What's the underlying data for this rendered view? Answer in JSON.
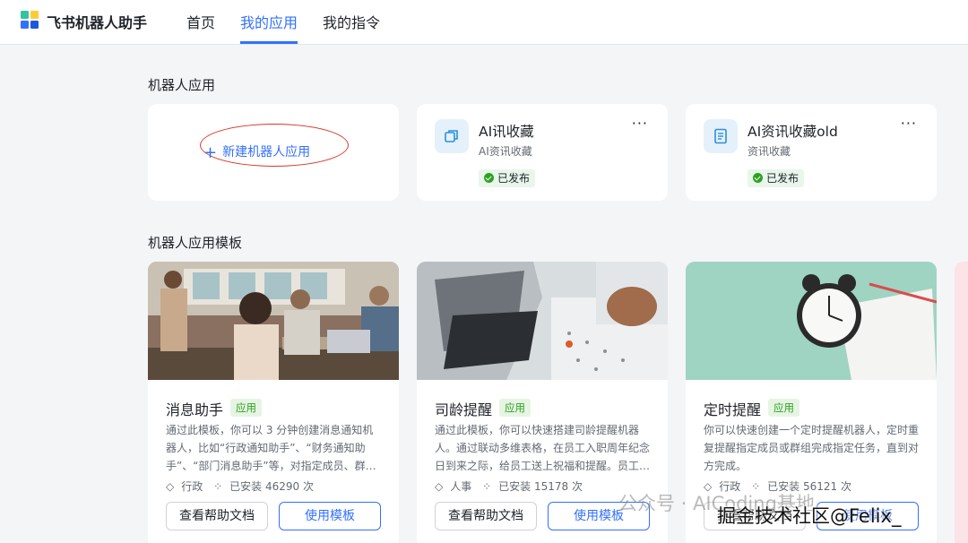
{
  "header": {
    "brand": "飞书机器人助手",
    "nav": [
      "首页",
      "我的应用",
      "我的指令"
    ],
    "active_nav": "我的应用"
  },
  "robot_apps": {
    "section_title": "机器人应用",
    "new_button_label": "新建机器人应用",
    "apps": [
      {
        "name": "AI讯收藏",
        "subtitle": "AI资讯收藏",
        "status": "已发布",
        "icon": "copy-icon"
      },
      {
        "name": "AI资讯收藏old",
        "subtitle": "资讯收藏",
        "status": "已发布",
        "icon": "document-icon"
      }
    ],
    "more_label": "···"
  },
  "templates": {
    "section_title": "机器人应用模板",
    "items": [
      {
        "title": "消息助手",
        "tag": "应用",
        "description": "通过此模板，你可以 3 分钟创建消息通知机器人，比如“行政通知助手”、“财务通知助手”、“部门消息助手”等，对指定成员、群…",
        "category": "行政",
        "installs": "已安装 46290 次",
        "help_label": "查看帮助文档",
        "use_label": "使用模板"
      },
      {
        "title": "司龄提醒",
        "tag": "应用",
        "description": "通过此模板，你可以快速搭建司龄提醒机器人。通过联动多维表格，在员工入职周年纪念日到来之际，给员工送上祝福和提醒。员工…",
        "category": "人事",
        "installs": "已安装 15178 次",
        "help_label": "查看帮助文档",
        "use_label": "使用模板"
      },
      {
        "title": "定时提醒",
        "tag": "应用",
        "description": "你可以快速创建一个定时提醒机器人，定时重复提醒指定成员或群组完成指定任务，直到对方完成。",
        "category": "行政",
        "installs": "已安装 56121 次",
        "help_label": "查看帮助文档",
        "use_label": "使用模板"
      }
    ]
  },
  "watermark": {
    "line1": "公众号 · AICoding基地",
    "line2": "掘金技术社区@Felix_"
  },
  "colors": {
    "accent": "#3370ff",
    "success": "#2ea121",
    "annotation_red": "#d9342b"
  }
}
